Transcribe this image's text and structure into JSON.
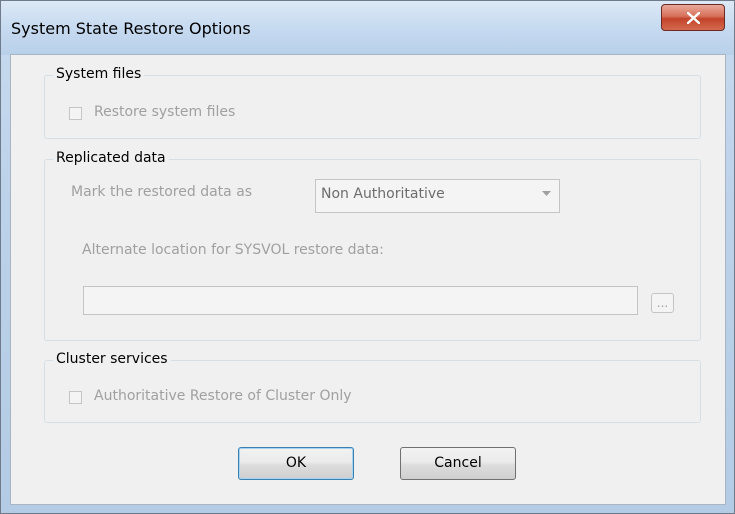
{
  "window": {
    "title": "System State Restore Options",
    "close_icon": "close-x-icon"
  },
  "system_files": {
    "group_title": "System files",
    "checkbox_label": "Restore system files",
    "checked": false,
    "enabled": false
  },
  "replicated_data": {
    "group_title": "Replicated data",
    "mark_label": "Mark the restored data as",
    "mark_value": "Non Authoritative",
    "sysvol_label": "Alternate location for SYSVOL restore data:",
    "sysvol_value": "",
    "browse_label": "...",
    "enabled": false
  },
  "cluster_services": {
    "group_title": "Cluster services",
    "checkbox_label": "Authoritative Restore of Cluster Only",
    "checked": false,
    "enabled": false
  },
  "buttons": {
    "ok": "OK",
    "cancel": "Cancel"
  }
}
